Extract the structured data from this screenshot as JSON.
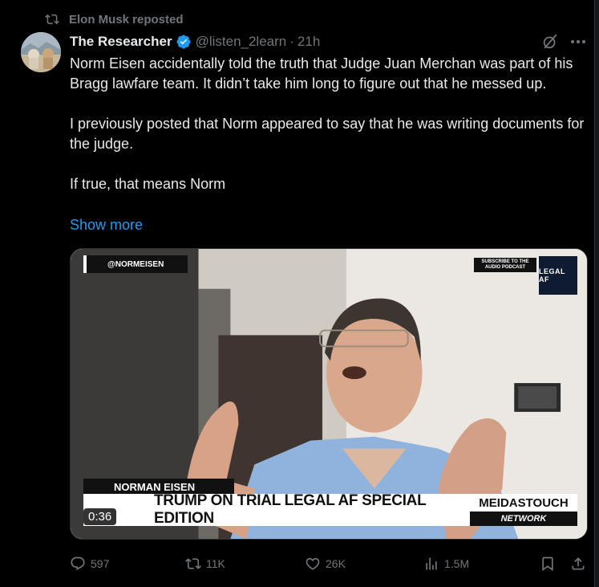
{
  "repost": {
    "label": "Elon Musk reposted",
    "icon": "repost-icon"
  },
  "author": {
    "name": "The Researcher",
    "handle": "@listen_2learn",
    "separator": "·",
    "time": "21h",
    "verified": true
  },
  "tweet": {
    "paragraphs": [
      "Norm Eisen accidentally told the truth that Judge Juan Merchan was part of his Bragg lawfare team. It didn’t take him long to figure out that he messed up.",
      "I previously posted that Norm appeared to say that he was writing documents for the judge.",
      "If true, that means Norm"
    ],
    "show_more": "Show more"
  },
  "media": {
    "overlay_handle": "@NORMEISEN",
    "subscribe_text": "SUBSCRIBE TO THE AUDIO PODCAST",
    "badge": "LEGAL AF",
    "name_tag": "NORMAN EISEN",
    "headline": "TRUMP ON TRIAL LEGAL AF SPECIAL EDITION",
    "brand": "MEIDASTOUCH",
    "brand_sub": "NETWORK",
    "duration": "0:36"
  },
  "actions": {
    "replies": "597",
    "reposts": "11K",
    "likes": "26K",
    "views": "1.5M"
  },
  "colors": {
    "background": "#000000",
    "text": "#e7e9ea",
    "muted": "#71767b",
    "link": "#1d9bf0",
    "verified": "#1d9bf0"
  }
}
